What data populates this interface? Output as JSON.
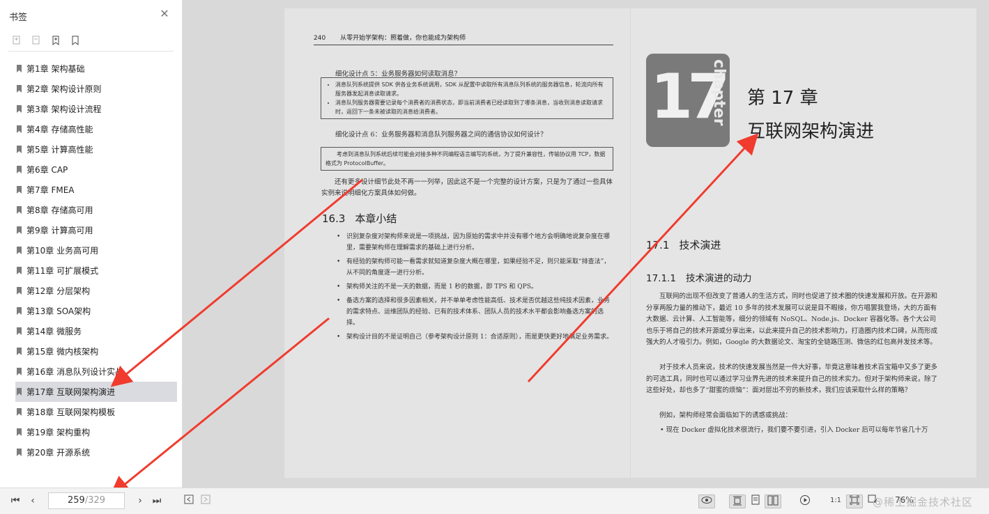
{
  "sidebar": {
    "title": "书签",
    "bookmarks": [
      "第1章 架构基础",
      "第2章 架构设计原则",
      "第3章 架构设计流程",
      "第4章 存储高性能",
      "第5章 计算高性能",
      "第6章 CAP",
      "第7章 FMEA",
      "第8章 存储高可用",
      "第9章 计算高可用",
      "第10章 业务高可用",
      "第11章 可扩展模式",
      "第12章 分层架构",
      "第13章 SOA架构",
      "第14章 微服务",
      "第15章 微内核架构",
      "第16章 消息队列设计实战",
      "第17章 互联网架构演进",
      "第18章 互联网架构模板",
      "第19章 架构重构",
      "第20章 开源系统"
    ],
    "active_index": 16
  },
  "left_page": {
    "page_number": "240",
    "running_head": "从零开始学架构：照着做，你也能成为架构师",
    "point5_title": "细化设计点 5：业务服务器如何读取消息？",
    "box1": [
      "消息队列系统提供 SDK 供各业务系统调用，SDK 从配置中读取所有消息队列系统的服务器信息，轮流向所有服务器发起消息读取请求。",
      "消息队列服务器需要记录每个消费者的消费状态，即当前消费者已经读取到了哪条消息，当收到消息读取请求时，返回下一条未被读取的消息给消费者。"
    ],
    "point6_title": "细化设计点 6：业务服务器和消息队列服务器之间的通信协议如何设计？",
    "box2": "考虑到消息队列系统后续可能会对接多种不同编程语言编写的系统，为了提升兼容性，传输协议用 TCP，数据格式为 ProtocolBuffer。",
    "closing_para": "还有更多设计细节此处不再一一列举，因此这不是一个完整的设计方案，只是为了通过一些具体实例来说明细化方案具体如何做。",
    "section_num": "16.3",
    "section_title": "本章小结",
    "summary": [
      "识别复杂度对架构师来说是一项挑战，因为原始的需求中并没有哪个地方会明确地说复杂度在哪里，需要架构师在理解需求的基础上进行分析。",
      "有经验的架构师可能一看需求就知道复杂度大概在哪里，如果经验不足，则只能采取“排查法”，从不同的角度逐一进行分析。",
      "架构师关注的不是一天的数据，而是 1 秒的数据，即 TPS 和 QPS。",
      "备选方案的选择和很多因素相关，并不单单考虑性能高低、技术是否优越这些纯技术因素，业务的需求特点、运维团队的经验、已有的技术体系、团队人员的技术水平都会影响备选方案的选择。",
      "架构设计目的不是证明自己（参考架构设计原则 1：合适原则），而是更快更好地满足业务需求。"
    ]
  },
  "right_page": {
    "chapter_logo_number": "17",
    "chapter_logo_word": "chapter",
    "chapter_label": "第 17 章",
    "chapter_title": "互联网架构演进",
    "section_num": "17.1",
    "section_title": "技术演进",
    "subsection_num": "17.1.1",
    "subsection_title": "技术演进的动力",
    "para1": "互联网的出现不但改变了普通人的生活方式，同时也促进了技术圈的快速发展和开放。在开源和分享两股力量的推动下，最近 10 多年的技术发展可以说是目不暇接，你方唱罢我登场，大的方面有大数据、云计算、人工智能等，细分的领域有 NoSQL、Node.js、Docker 容器化等。各个大公司也乐于将自己的技术开源或分享出来，以此来提升自己的技术影响力，打造圈内技术口碑，从而形成强大的人才吸引力。例如，Google 的大数据论文、淘宝的全链路压测、微信的红包高并发技术等。",
    "para2": "对于技术人员来说，技术的快速发展当然是一件大好事，毕竟这意味着技术百宝箱中又多了更多的可选工具，同时也可以通过学习业界先进的技术来提升自己的技术实力。但对于架构师来说，除了这些好处，却也多了“甜蜜的烦恼”：面对层出不穷的新技术，我们应该采取什么样的策略？",
    "para3": "例如，架构师经常会面临如下的诱惑或挑战：",
    "para4": "现在 Docker 虚拟化技术很流行，我们要不要引进，引入 Docker 后可以每年节省几十万"
  },
  "toolbar": {
    "current_page": "259",
    "total_pages": "/329",
    "zoom": "76%",
    "watermark": "@稀土掘金技术社区"
  },
  "colors": {
    "arrow": "#f03b2e",
    "active_bookmark": "#d9dbe0",
    "viewer_bg": "#d9d9d9"
  }
}
